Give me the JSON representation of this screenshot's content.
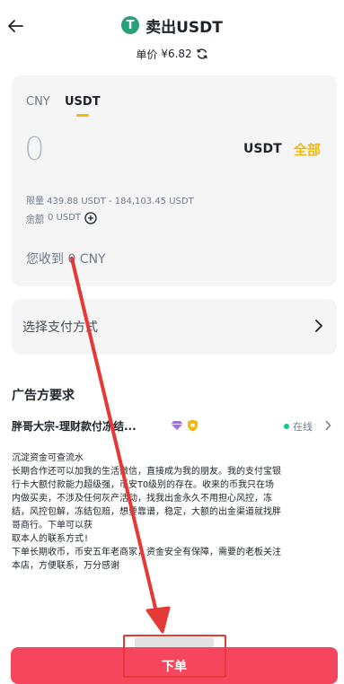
{
  "header": {
    "back_icon": "arrow-left-icon",
    "coin_icon_letter": "T",
    "title": "卖出USDT",
    "price_label": "单价",
    "price_value": "¥6.82",
    "refresh_icon": "refresh-icon"
  },
  "amount_card": {
    "tabs": [
      {
        "label": "CNY",
        "active": false
      },
      {
        "label": "USDT",
        "active": true
      }
    ],
    "amount_value": "0",
    "unit": "USDT",
    "all_label": "全部",
    "limit_text": "限量 439.88 USDT - 184,103.45 USDT",
    "balance_label": "余额",
    "balance_value": "0 USDT",
    "receive_text": "您收到 0 CNY"
  },
  "payment": {
    "label": "选择支付方式"
  },
  "advertiser": {
    "section_title": "广告方要求",
    "name": "胖哥大宗-理财款付冻结...",
    "status": "在线",
    "requirements": "沉淀资金可查流水\n长期合作还可以加我的生活微信，直接成为我的朋友。我的支付宝银\n行卡大额付款能力超级强，币安TO级别的存在。收来的币我只在场\n内做买卖，不涉及任何灰产活动，找我出金永久不用担心风控，冻\n结，风控包解，冻结包赔，想要靠谱，稳定，大额的出金渠道就找胖\n哥商行。下单可以获\n取本人的联系方式!\n下单长期收币，币安五年老商家，资金安全有保障，需要的老板关注\n本店，方便联系，万分感谢"
  },
  "footer": {
    "sell_button_label": "下单"
  },
  "colors": {
    "accent_yellow": "#f0b90b",
    "sell_red": "#f6465d",
    "online_green": "#0ecb81",
    "tether_green": "#26a17b",
    "annotation_red": "#e53935"
  }
}
